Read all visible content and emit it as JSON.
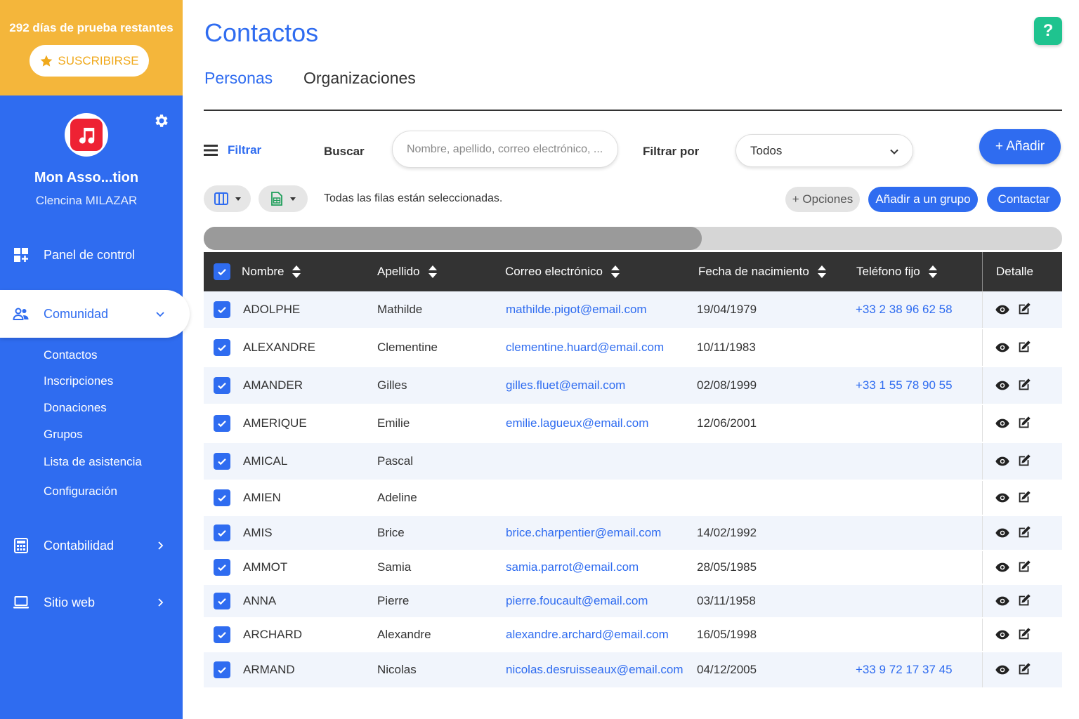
{
  "trial": {
    "text": "292 días de prueba restantes",
    "subscribe_label": "SUSCRIBIRSE"
  },
  "profile": {
    "org_name": "Mon Asso...tion",
    "user_name": "Clencina MILAZAR"
  },
  "nav": {
    "dashboard": "Panel de control",
    "community": "Comunidad",
    "sub_items": [
      "Contactos",
      "Inscripciones",
      "Donaciones",
      "Grupos",
      "Lista de asistencia",
      "Configuración"
    ],
    "accounting": "Contabilidad",
    "website": "Sitio web"
  },
  "page": {
    "title": "Contactos",
    "tabs": [
      "Personas",
      "Organizaciones"
    ]
  },
  "toolbar": {
    "filter_label": "Filtrar",
    "search_label": "Buscar",
    "search_placeholder": "Nombre, apellido, correo electrónico, ...",
    "filter_by_label": "Filtrar por",
    "filter_by_value": "Todos",
    "add_label": "+ Añadir",
    "selected_message": "Todas las filas están seleccionadas.",
    "options_label": "+ Opciones",
    "add_group_label": "Añadir a un grupo",
    "contact_label": "Contactar"
  },
  "table": {
    "headers": {
      "first": "Nombre",
      "last": "Apellido",
      "email": "Correo electrónico",
      "birth": "Fecha de nacimiento",
      "phone": "Teléfono fijo",
      "detail": "Detalle"
    },
    "rows": [
      {
        "first": "ADOLPHE",
        "last": "Mathilde",
        "email": "mathilde.pigot@email.com",
        "birth": "19/04/1979",
        "phone": "+33 2 38 96 62 58"
      },
      {
        "first": "ALEXANDRE",
        "last": "Clementine",
        "email": "clementine.huard@email.com",
        "birth": "10/11/1983",
        "phone": ""
      },
      {
        "first": "AMANDER",
        "last": "Gilles",
        "email": "gilles.fluet@email.com",
        "birth": "02/08/1999",
        "phone": "+33 1 55 78 90 55"
      },
      {
        "first": "AMERIQUE",
        "last": "Emilie",
        "email": "emilie.lagueux@email.com",
        "birth": "12/06/2001",
        "phone": ""
      },
      {
        "first": "AMICAL",
        "last": "Pascal",
        "email": "",
        "birth": "",
        "phone": ""
      },
      {
        "first": "AMIEN",
        "last": "Adeline",
        "email": "",
        "birth": "",
        "phone": ""
      },
      {
        "first": "AMIS",
        "last": "Brice",
        "email": "brice.charpentier@email.com",
        "birth": "14/02/1992",
        "phone": ""
      },
      {
        "first": "AMMOT",
        "last": "Samia",
        "email": "samia.parrot@email.com",
        "birth": "28/05/1985",
        "phone": ""
      },
      {
        "first": "ANNA",
        "last": "Pierre",
        "email": "pierre.foucault@email.com",
        "birth": "03/11/1958",
        "phone": ""
      },
      {
        "first": "ARCHARD",
        "last": "Alexandre",
        "email": "alexandre.archard@email.com",
        "birth": "16/05/1998",
        "phone": ""
      },
      {
        "first": "ARMAND",
        "last": "Nicolas",
        "email": "nicolas.desruisseaux@email.com",
        "birth": "04/12/2005",
        "phone": "+33 9 72 17 37 45"
      }
    ]
  },
  "icons": {
    "gear": "gear-icon",
    "help": "?",
    "star": "star-icon",
    "menu": "menu-icon",
    "view": "eye-icon",
    "edit": "edit-icon"
  },
  "colors": {
    "primary": "#2f6cf0",
    "trial": "#f4b63b",
    "help": "#1fc38f",
    "header": "#333333"
  }
}
